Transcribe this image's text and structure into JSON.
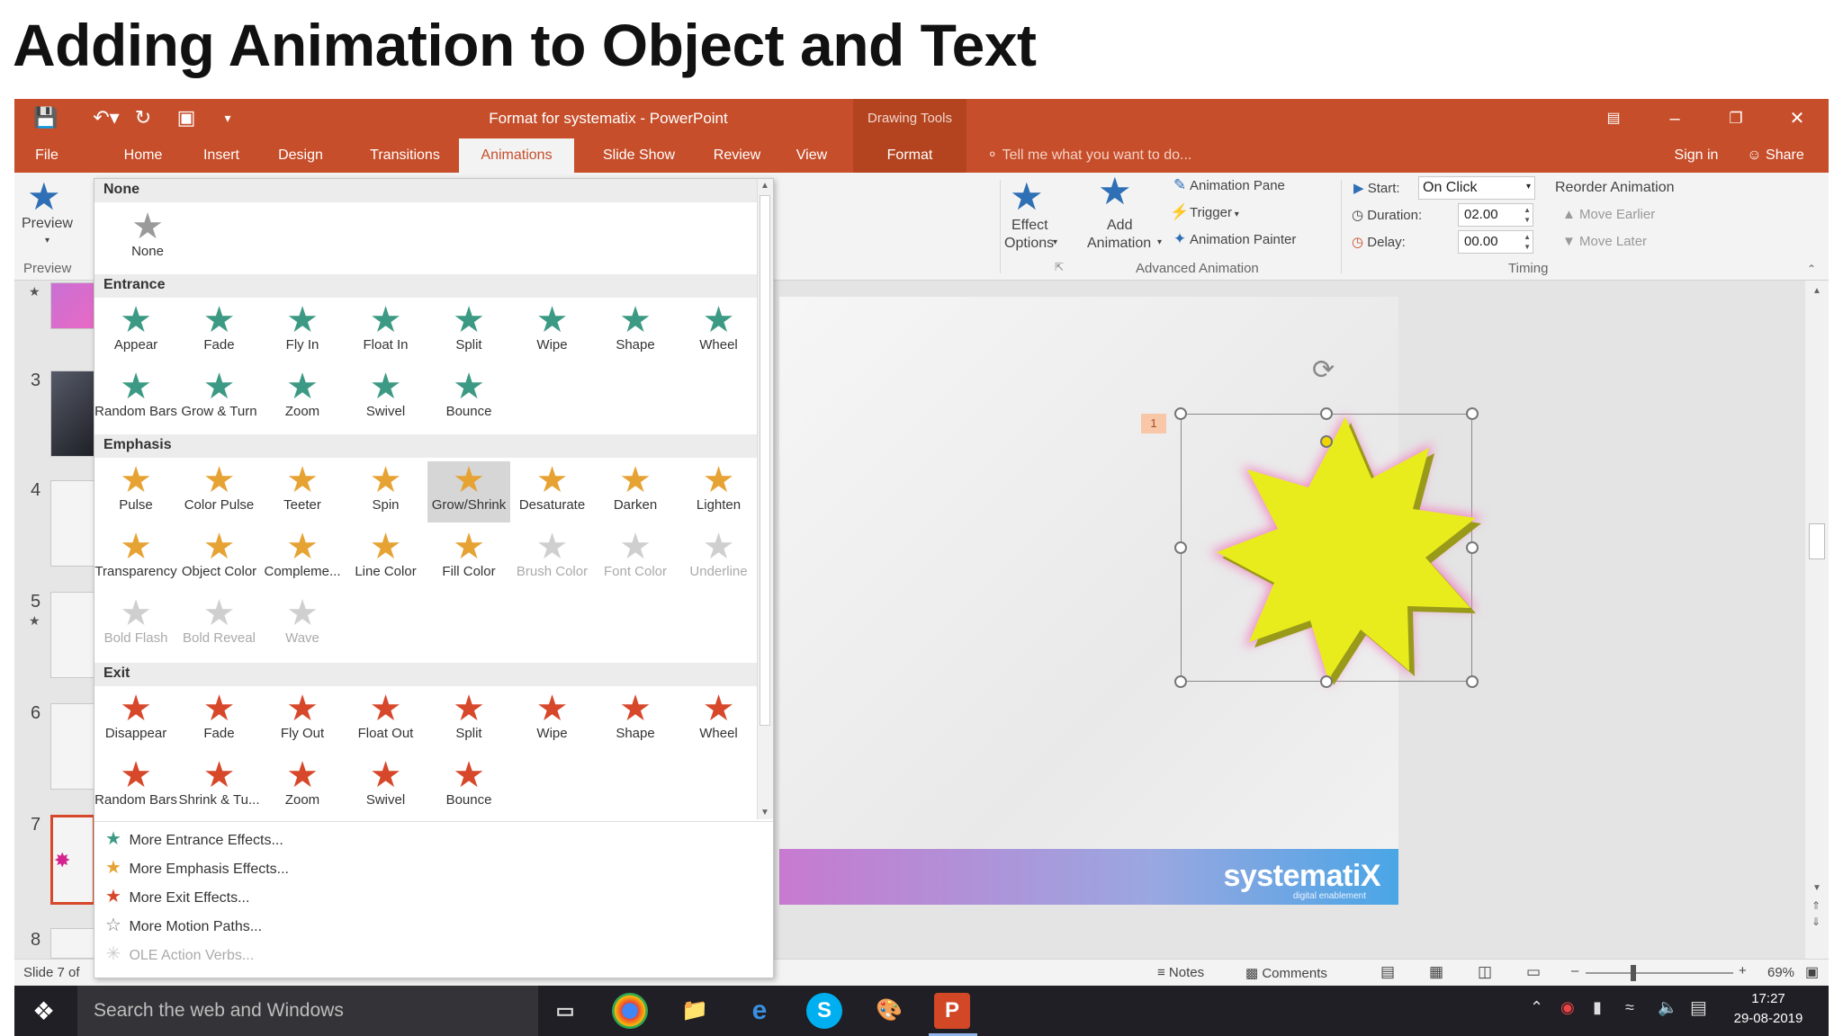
{
  "heading": "Adding Animation to Object and Text",
  "window": {
    "title": "Format for systematix - PowerPoint",
    "contextual_group": "Drawing Tools",
    "sign_in": "Sign in",
    "share": "Share"
  },
  "tabs": [
    "File",
    "Home",
    "Insert",
    "Design",
    "Transitions",
    "Animations",
    "Slide Show",
    "Review",
    "View",
    "Format"
  ],
  "active_tab": "Animations",
  "tell_me": "Tell me what you want to do...",
  "ribbon": {
    "preview": "Preview",
    "preview_group": "Preview",
    "effect_options_1": "Effect",
    "effect_options_2": "Options",
    "add_animation_1": "Add",
    "add_animation_2": "Animation",
    "animation_pane": "Animation Pane",
    "trigger": "Trigger",
    "animation_painter": "Animation Painter",
    "advanced_group": "Advanced Animation",
    "start_label": "Start:",
    "start_value": "On Click",
    "duration_label": "Duration:",
    "duration_value": "02.00",
    "delay_label": "Delay:",
    "delay_value": "00.00",
    "reorder": "Reorder Animation",
    "move_earlier": "Move Earlier",
    "move_later": "Move Later",
    "timing_group": "Timing"
  },
  "gallery": {
    "none_header": "None",
    "none_item": "None",
    "entrance_header": "Entrance",
    "entrance": [
      "Appear",
      "Fade",
      "Fly In",
      "Float In",
      "Split",
      "Wipe",
      "Shape",
      "Wheel",
      "Random Bars",
      "Grow & Turn",
      "Zoom",
      "Swivel",
      "Bounce"
    ],
    "emphasis_header": "Emphasis",
    "emphasis": [
      "Pulse",
      "Color Pulse",
      "Teeter",
      "Spin",
      "Grow/Shrink",
      "Desaturate",
      "Darken",
      "Lighten",
      "Transparency",
      "Object Color",
      "Compleme...",
      "Line Color",
      "Fill Color",
      "Brush Color",
      "Font Color",
      "Underline",
      "Bold Flash",
      "Bold Reveal",
      "Wave"
    ],
    "emphasis_selected": "Grow/Shrink",
    "exit_header": "Exit",
    "exit": [
      "Disappear",
      "Fade",
      "Fly Out",
      "Float Out",
      "Split",
      "Wipe",
      "Shape",
      "Wheel",
      "Random Bars",
      "Shrink & Tu...",
      "Zoom",
      "Swivel",
      "Bounce"
    ],
    "more": [
      "More Entrance Effects...",
      "More Emphasis Effects...",
      "More Exit Effects...",
      "More Motion Paths...",
      "OLE Action Verbs..."
    ]
  },
  "thumbnails": [
    "3",
    "4",
    "5",
    "6",
    "7",
    "8"
  ],
  "slide": {
    "animation_tag": "1",
    "logo": "systematiX",
    "logo_sub": "digital enablement"
  },
  "status": {
    "slide_of": "Slide 7 of",
    "notes": "Notes",
    "comments": "Comments",
    "zoom": "69%"
  },
  "taskbar": {
    "search": "Search the web and Windows",
    "time": "17:27",
    "date": "29-08-2019"
  }
}
